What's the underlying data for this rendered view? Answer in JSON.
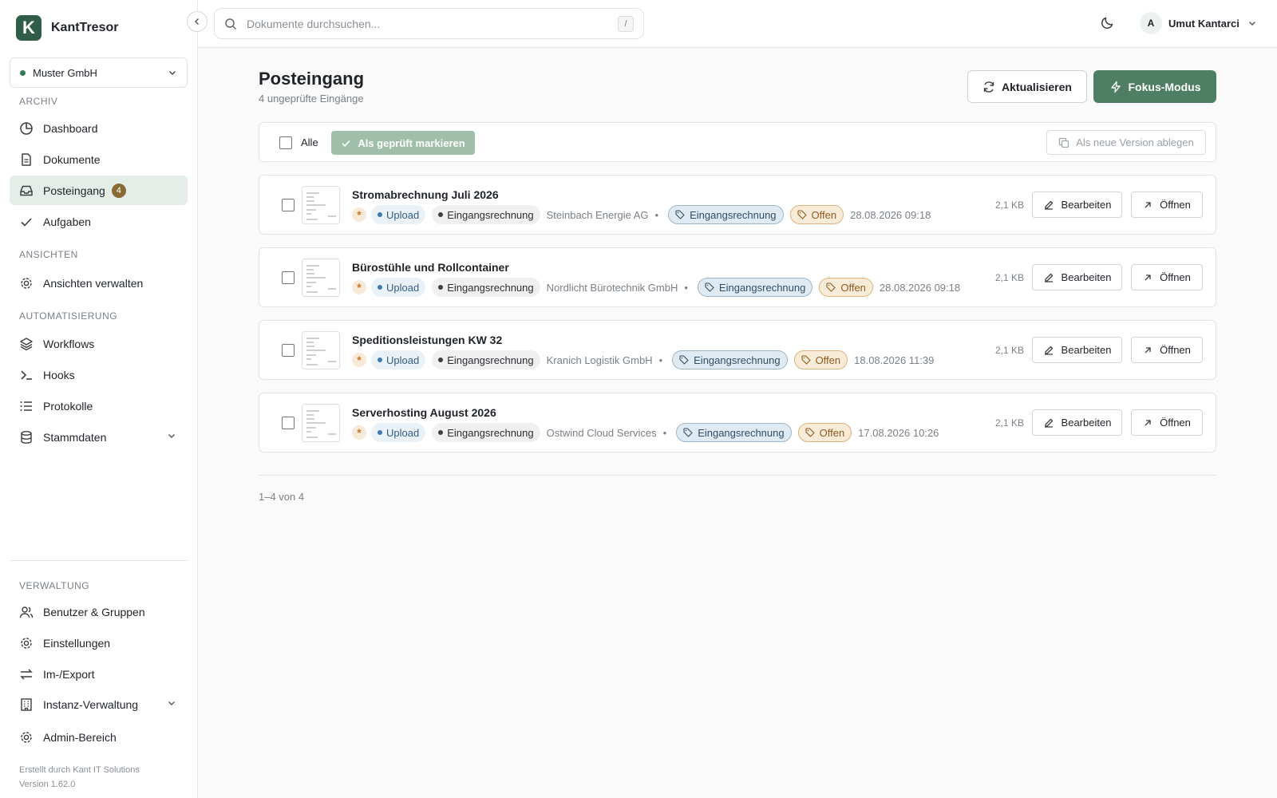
{
  "app": {
    "name": "KantTresor",
    "logo_letter": "K"
  },
  "org": {
    "name": "Muster GmbH"
  },
  "sidebar": {
    "sections": {
      "archiv": "ARCHIV",
      "ansichten": "ANSICHTEN",
      "automatisierung": "AUTOMATISIERUNG",
      "verwaltung": "VERWALTUNG"
    },
    "items": {
      "dashboard": "Dashboard",
      "dokumente": "Dokumente",
      "posteingang": "Posteingang",
      "posteingang_badge": "4",
      "aufgaben": "Aufgaben",
      "ansichten_verwalten": "Ansichten verwalten",
      "workflows": "Workflows",
      "hooks": "Hooks",
      "protokolle": "Protokolle",
      "stammdaten": "Stammdaten",
      "benutzer": "Benutzer & Gruppen",
      "einstellungen": "Einstellungen",
      "import_export": "Im-/Export",
      "instanz": "Instanz-Verwaltung",
      "admin": "Admin-Bereich"
    },
    "active": "posteingang",
    "footer": {
      "credit": "Erstellt durch Kant IT Solutions",
      "version": "Version 1.62.0"
    }
  },
  "topbar": {
    "search_placeholder": "Dokumente durchsuchen...",
    "search_shortcut": "/",
    "user": {
      "initial": "A",
      "name": "Umut Kantarci"
    }
  },
  "page": {
    "title": "Posteingang",
    "subtitle": "4 ungeprüfte Eingänge",
    "refresh_label": "Aktualisieren",
    "focus_label": "Fokus-Modus",
    "bulk": {
      "all_label": "Alle",
      "mark_label": "Als geprüft markieren",
      "version_label": "Als neue Version ablegen"
    },
    "pagination": "1–4 von 4"
  },
  "documents": [
    {
      "title": "Stromabrechnung Juli 2026",
      "source": "Upload",
      "doctype": "Eingangsrechnung",
      "correspondent": "Steinbach Energie AG",
      "tag": "Eingangsrechnung",
      "status": "Offen",
      "date": "28.08.2026 09:18",
      "size": "2,1 KB",
      "edit_label": "Bearbeiten",
      "open_label": "Öffnen"
    },
    {
      "title": "Bürostühle und Rollcontainer",
      "source": "Upload",
      "doctype": "Eingangsrechnung",
      "correspondent": "Nordlicht Bürotechnik GmbH",
      "tag": "Eingangsrechnung",
      "status": "Offen",
      "date": "28.08.2026 09:18",
      "size": "2,1 KB",
      "edit_label": "Bearbeiten",
      "open_label": "Öffnen"
    },
    {
      "title": "Speditionsleistungen KW 32",
      "source": "Upload",
      "doctype": "Eingangsrechnung",
      "correspondent": "Kranich Logistik GmbH",
      "tag": "Eingangsrechnung",
      "status": "Offen",
      "date": "18.08.2026 11:39",
      "size": "2,1 KB",
      "edit_label": "Bearbeiten",
      "open_label": "Öffnen"
    },
    {
      "title": "Serverhosting August 2026",
      "source": "Upload",
      "doctype": "Eingangsrechnung",
      "correspondent": "Ostwind Cloud Services",
      "tag": "Eingangsrechnung",
      "status": "Offen",
      "date": "17.08.2026 10:26",
      "size": "2,1 KB",
      "edit_label": "Bearbeiten",
      "open_label": "Öffnen"
    }
  ],
  "colors": {
    "brand": "#2f5d48",
    "primary_button": "#4e7f65",
    "active_nav": "#e4ede8",
    "badge": "#8a6a34",
    "tag_blue": "#e0eaf2",
    "status_orange": "#f8ecd9"
  },
  "icons": {
    "theme": "moon-icon",
    "refresh": "refresh-icon",
    "focus": "lightning-icon",
    "edit": "pencil-icon",
    "open": "arrow-up-right-icon"
  }
}
